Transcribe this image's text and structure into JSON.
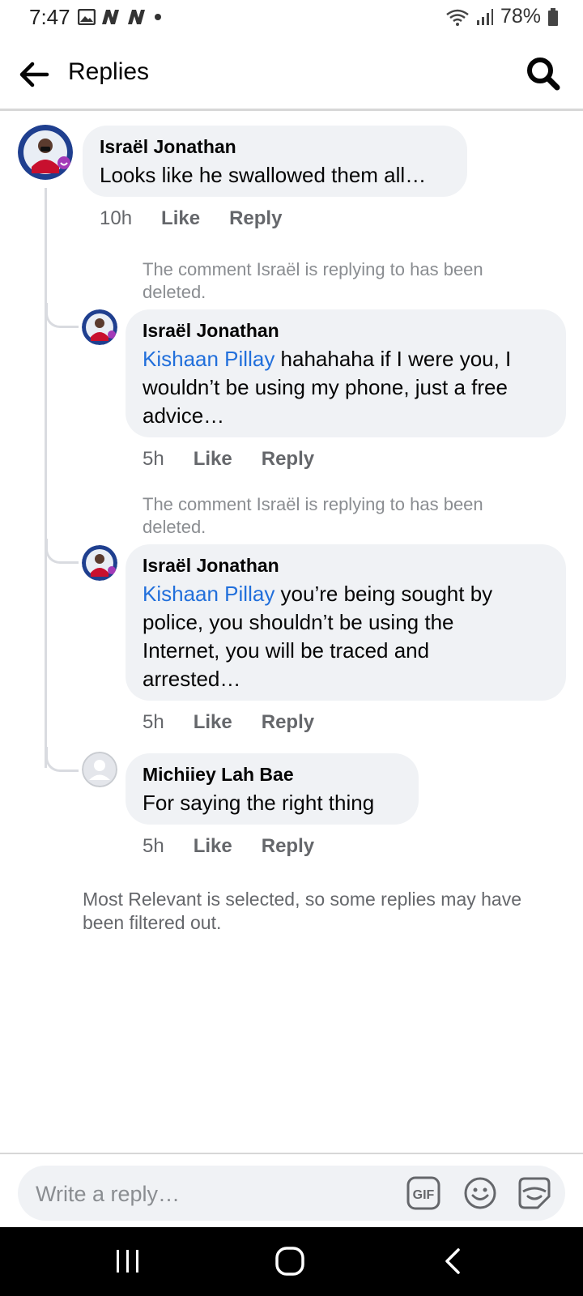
{
  "status_bar": {
    "time": "7:47",
    "battery": "78%"
  },
  "header": {
    "title": "Replies"
  },
  "comments": [
    {
      "author": "Israël Jonathan",
      "text": "Looks like he swallowed them all…",
      "time": "10h",
      "like": "Like",
      "reply": "Reply"
    },
    {
      "deleted_note": "The comment Israël is replying to has been deleted.",
      "author": "Israël Jonathan",
      "mention": "Kishaan Pillay",
      "text_line1": " hahahaha if I were you, I",
      "text_line2": "wouldn’t be using my phone, just a free",
      "text_line3": "advice…",
      "time": "5h",
      "like": "Like",
      "reply": "Reply"
    },
    {
      "deleted_note": "The comment Israël is replying to has been deleted.",
      "author": "Israël Jonathan",
      "mention": "Kishaan Pillay",
      "text_line1": " you’re being sought by",
      "text_line2": "police, you shouldn’t be using the",
      "text_line3": "Internet, you will be traced and",
      "text_line4": "arrested…",
      "time": "5h",
      "like": "Like",
      "reply": "Reply"
    },
    {
      "author": "Michiiey Lah Bae",
      "text": "For saying the right thing",
      "time": "5h",
      "like": "Like",
      "reply": "Reply"
    }
  ],
  "footnote": "Most Relevant is selected, so some replies may have been filtered out.",
  "composer": {
    "placeholder": "Write a reply…",
    "gif_label": "GIF"
  },
  "colors": {
    "mention": "#216fdb",
    "bubble": "#f0f2f5",
    "meta": "#65676b"
  }
}
